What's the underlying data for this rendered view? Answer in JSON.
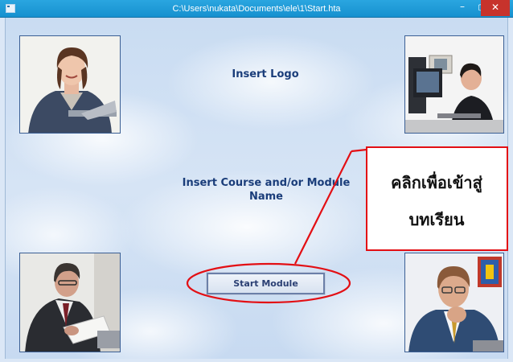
{
  "window": {
    "title": "C:\\Users\\nukata\\Documents\\ele\\1\\Start.hta",
    "controls": {
      "minimize": "–",
      "maximize": "▢",
      "close": "✕"
    },
    "accent_color": "#1b96d4",
    "close_color": "#c7332c"
  },
  "page": {
    "logo_placeholder": "Insert Logo",
    "course_name_line1": "Insert Course and/or Module",
    "course_name_line2": "Name",
    "start_button_label": "Start Module"
  },
  "photos": {
    "top_left": "smiling-businesswoman-photo",
    "top_right": "man-at-computer-photo",
    "bottom_left": "man-reading-document-photo",
    "bottom_right": "thinking-man-photo"
  },
  "annotation": {
    "callout_line1": "คลิกเพื่อเข้าสู่",
    "callout_line2": "บทเรียน",
    "color": "#e30f14"
  }
}
